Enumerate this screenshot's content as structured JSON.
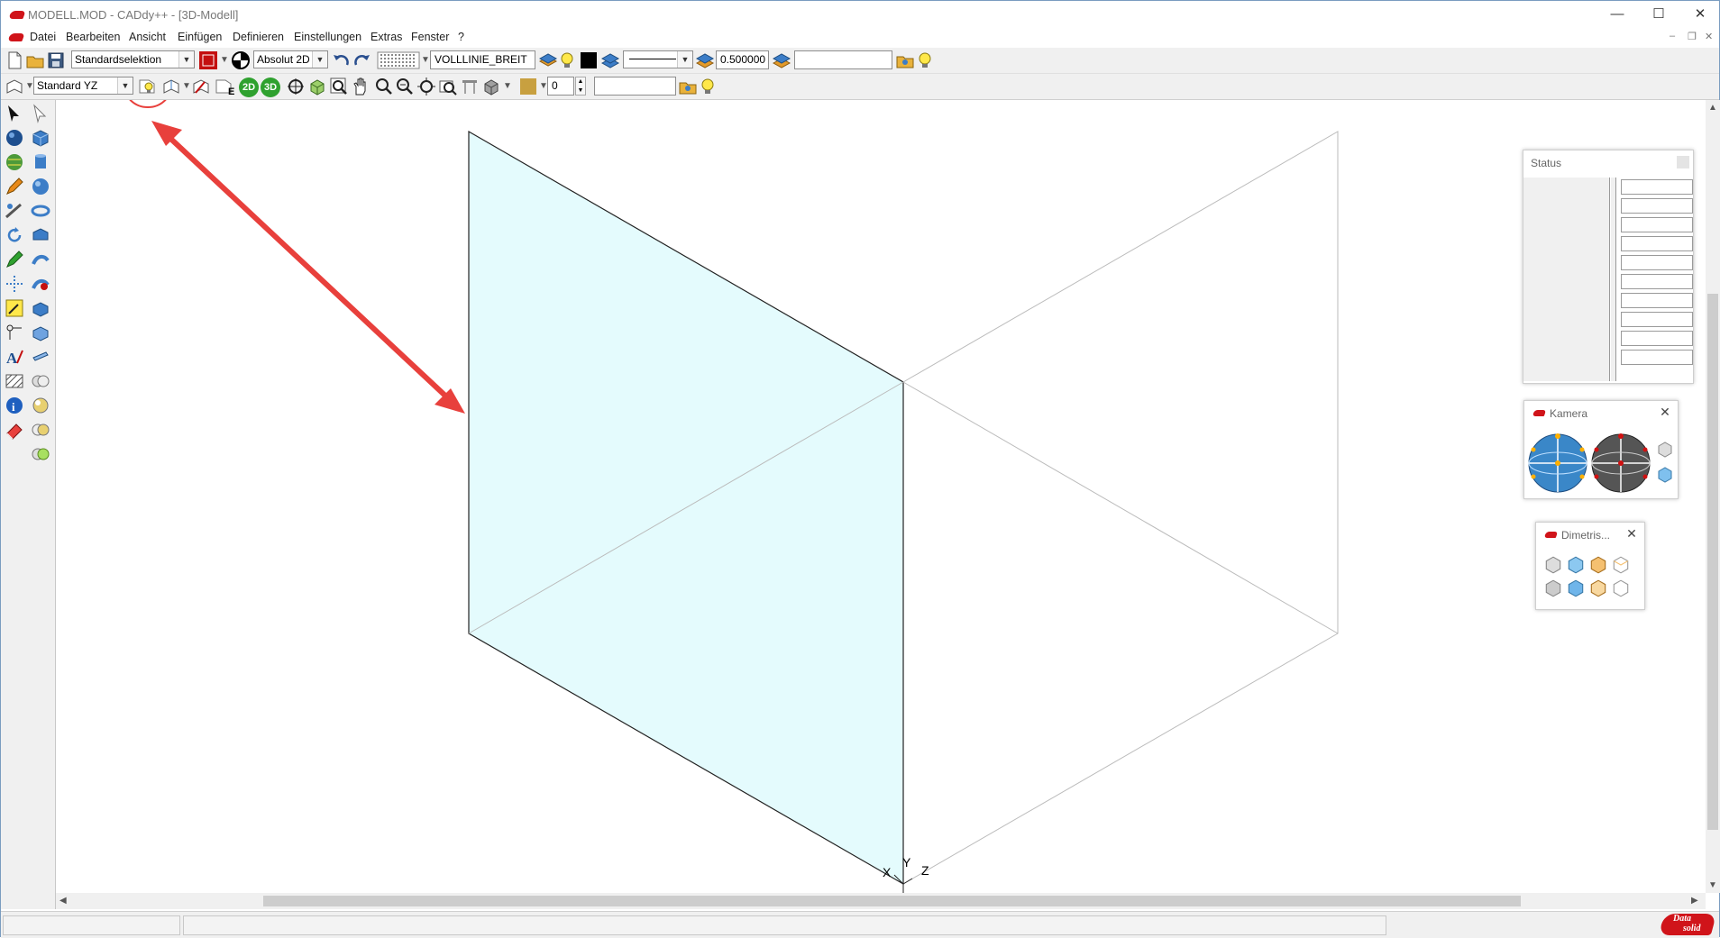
{
  "window": {
    "title": "MODELL.MOD  -  CADdy++ - [3D-Modell]",
    "min": "—",
    "max": "☐",
    "close": "✕"
  },
  "menu": {
    "items": [
      "Datei",
      "Bearbeiten",
      "Ansicht",
      "Einfügen",
      "Definieren",
      "Einstellungen",
      "Extras",
      "Fenster",
      "?"
    ],
    "mdi_min": "–",
    "mdi_restore": "❐",
    "mdi_close": "✕"
  },
  "toolbar1": {
    "selection_mode": "Standardselektion",
    "coord_mode": "Absolut 2D",
    "line_type": "VOLLLINIE_BREIT",
    "line_width": "0.500000",
    "layer_name": ""
  },
  "toolbar2": {
    "view_mode": "Standard YZ",
    "btn_2d": "2D",
    "btn_3d": "3D",
    "e_label": "E",
    "number_value": "0",
    "name_field": ""
  },
  "panels": {
    "status_title": "Status",
    "status_cells": [
      "",
      "",
      "",
      "",
      "",
      "",
      "",
      "",
      "",
      ""
    ],
    "kamera_title": "Kamera",
    "dimetrie_title": "Dimetris..."
  },
  "canvas": {
    "axis_x": "X",
    "axis_y": "Y",
    "axis_z": "Z",
    "plane_fill": "#e4fbfd"
  },
  "annotation": {
    "color": "#e8403c"
  },
  "statusbar": {
    "logo_top": "Data",
    "logo_bottom": "solid"
  }
}
